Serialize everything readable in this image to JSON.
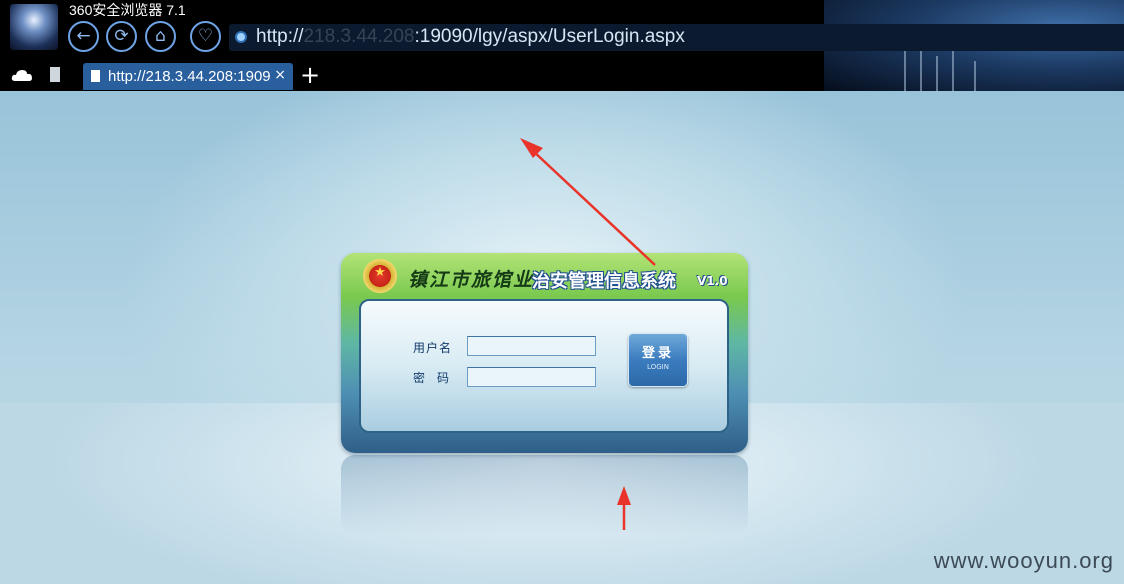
{
  "browser": {
    "title": "360安全浏览器 7.1",
    "address": {
      "url_prefix": "http://",
      "url_host_hidden": "218.3.44.208",
      "url_rest": ":19090/lgy/aspx/UserLogin.aspx"
    },
    "tab": {
      "label": "http://218.3.44.208:1909",
      "close_symbol": "×"
    },
    "new_tab_symbol": "+",
    "nav_icons": [
      "back-icon",
      "refresh-icon",
      "home-icon",
      "favorites-icon"
    ]
  },
  "login": {
    "brand_name": "镇江市旅馆业",
    "system_name": "治安管理信息系统",
    "version": "V1.0",
    "username_label": "用户名",
    "password_label": "密码",
    "username_value": "",
    "password_value": "",
    "login_button_cn": "登录",
    "login_button_en": "LOGIN"
  },
  "watermark": "www.wooyun.org",
  "colors": {
    "page_bg": "#a9cfe1",
    "panel_green": "#79c94e",
    "panel_blue": "#2f5f88",
    "arrow_red": "#e8342a"
  }
}
